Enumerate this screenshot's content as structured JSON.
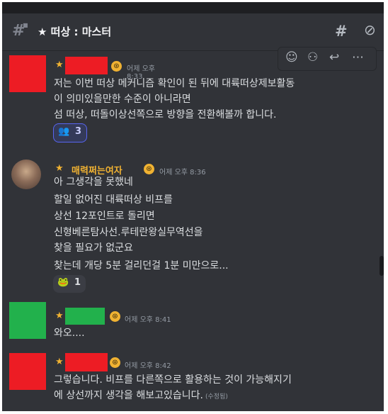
{
  "header": {
    "channel_icon": "hash-lock-icon",
    "channel_name": "★ 떠상 : 마스터",
    "icons": [
      "threads-icon",
      "bell-slash-icon"
    ]
  },
  "hover_toolbar": {
    "icons": [
      "add-reaction-icon",
      "super-reaction-icon",
      "reply-icon",
      "more-icon"
    ],
    "glyphs": [
      "☺",
      "⚇",
      "↩",
      "⋯"
    ]
  },
  "colors": {
    "background": "#313338",
    "text": "#dbdee1",
    "timestamp": "#949ba4",
    "star": "#f0b232",
    "username_gold": "#f0b232",
    "avatar_red": "#ed1c24",
    "avatar_green": "#22b14c"
  },
  "messages": [
    {
      "star": "★",
      "username": "",
      "username_redacted": true,
      "username_redaction_color": "#ed1c24",
      "avatar_color": "#ed1c24",
      "timestamp": "어제 오후 8:33",
      "lines": [
        "저는 이번 떠상 메커니즘 확인이 된 뒤에 대륙떠상제보활동",
        "이 의미있을만한 수준이 아니라면",
        "섬 떠상, 떠돌이상선쪽으로 방향을 전환해볼까 합니다."
      ],
      "reaction": {
        "emoji": "👥",
        "count": "3",
        "reacted": true
      }
    },
    {
      "star": "★",
      "username": "매력쩌는여자",
      "username_redacted": false,
      "avatar_color": "#6b5a4f",
      "timestamp": "어제 오후 8:36",
      "lines": [
        "아 그생각을 못했네",
        "할일 없어진 대륙떠상 비프를",
        "상선 12포인트로 돌리면",
        "신형베른탐사선.루테란왕실무역선을",
        "찾을 필요가 없군요",
        "찾는데 개당 5분 걸리던걸 1분 미만으로..."
      ],
      "reaction": {
        "emoji": "🐸",
        "count": "1",
        "reacted": false
      }
    },
    {
      "star": "★",
      "username": "",
      "username_redacted": true,
      "username_redaction_color": "#22b14c",
      "avatar_color": "#22b14c",
      "timestamp": "어제 오후 8:41",
      "lines": [
        "와오...."
      ]
    },
    {
      "star": "★",
      "username": "",
      "username_redacted": true,
      "username_redaction_color": "#ed1c24",
      "avatar_color": "#ed1c24",
      "timestamp": "어제 오후 8:42",
      "lines": [
        "그렇습니다. 비프를 다른쪽으로 활용하는 것이 가능해지기",
        "에 상선까지 생각을 해보고있습니다."
      ],
      "edited_label": "(수정됨)"
    }
  ]
}
